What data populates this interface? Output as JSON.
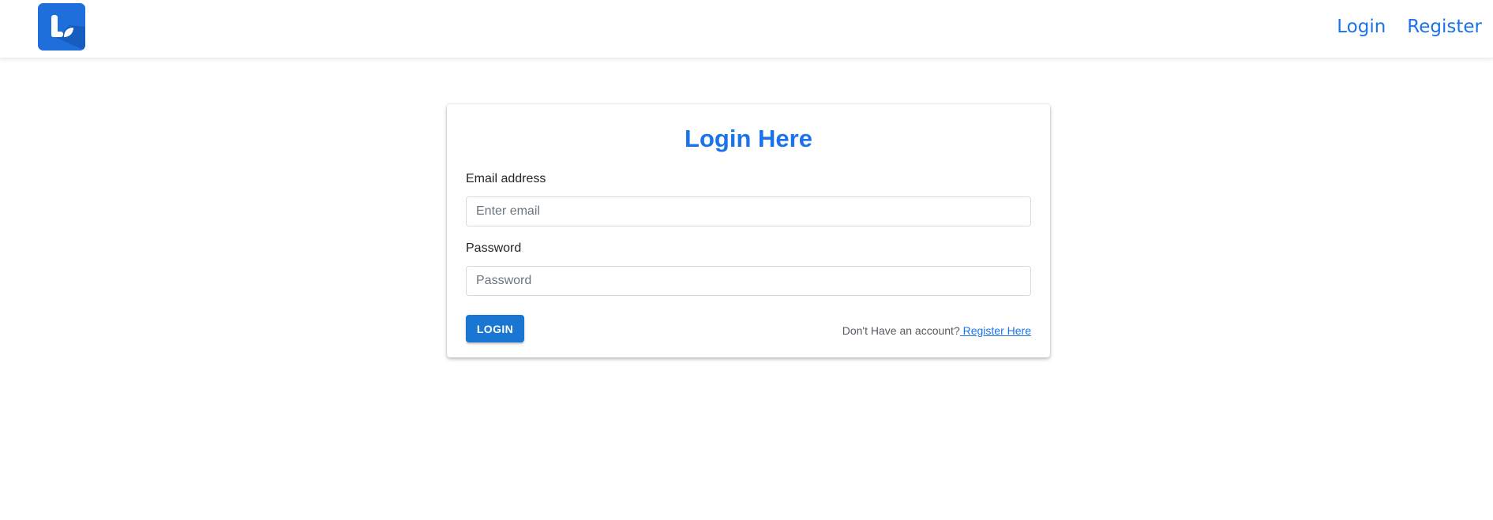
{
  "nav": {
    "logo_icon": "brand-logo-icon",
    "links": [
      {
        "label": "Login"
      },
      {
        "label": "Register"
      }
    ]
  },
  "form": {
    "title": "Login Here",
    "email": {
      "label": "Email address",
      "placeholder": "Enter email",
      "value": ""
    },
    "password": {
      "label": "Password",
      "placeholder": "Password",
      "value": ""
    },
    "submit_label": "LOGIN",
    "signup_prompt": "Don't Have an account?",
    "signup_link": " Register Here"
  },
  "colors": {
    "accent": "#1a73e8",
    "button": "#1976d2",
    "logo_bg": "#1e6fdc"
  }
}
